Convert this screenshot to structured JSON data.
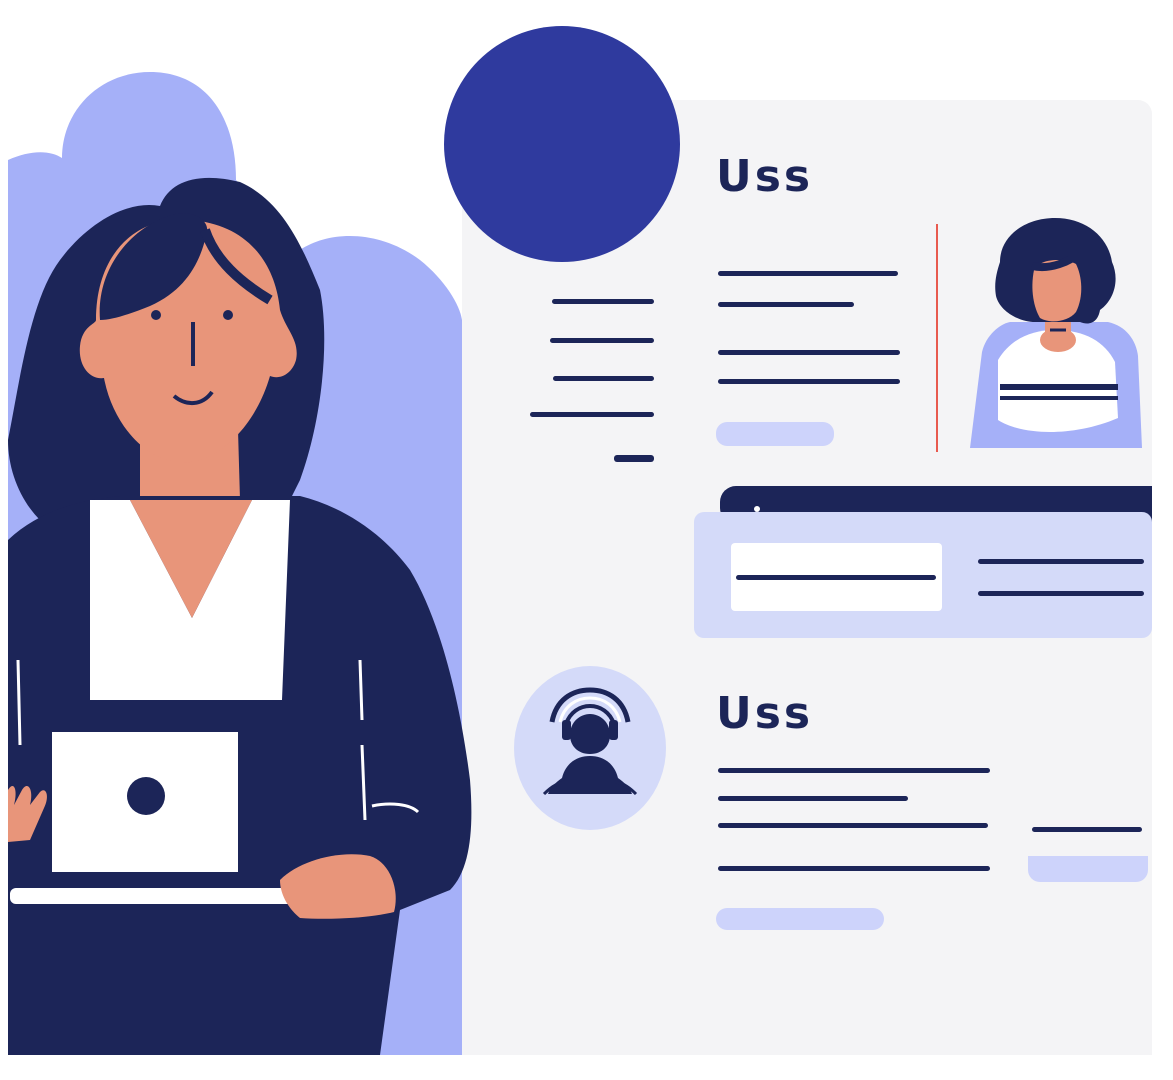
{
  "sections": [
    {
      "title": "Uss"
    },
    {
      "title": "Uss"
    }
  ],
  "colors": {
    "navy": "#1c2558",
    "periwinkle": "#a5b0f8",
    "light_periwinkle": "#d4daf9",
    "skin": "#e8957a",
    "panel": "#f4f4f6",
    "blue_circle": "#2f3a9e",
    "accent_red": "#e85a4f"
  },
  "icons": [
    "person-avatar-icon",
    "headset-support-icon",
    "laptop-icon"
  ]
}
